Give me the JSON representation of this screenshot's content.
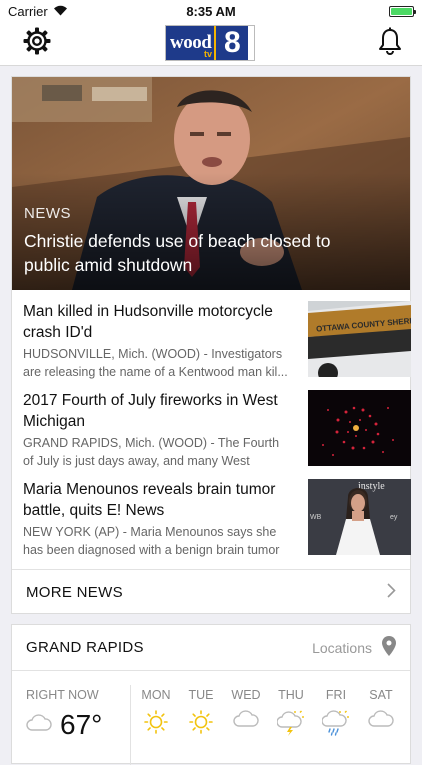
{
  "status_bar": {
    "carrier": "Carrier",
    "time": "8:35 AM",
    "battery_level": 1.0
  },
  "nav": {
    "settings_icon": "gear-icon",
    "logo_word": "wood",
    "logo_number": "8",
    "logo_tv": "tv",
    "notifications_icon": "bell-icon"
  },
  "hero": {
    "category": "NEWS",
    "headline": "Christie defends use of beach closed to public amid shutdown"
  },
  "stories": [
    {
      "title": "Man killed in Hudsonville motorcycle crash ID'd",
      "summary": "HUDSONVILLE, Mich. (WOOD) - Investigators are releasing the name of a Kentwood man kil...",
      "thumb_text": "OTTAWA COUNTY SHERIFF"
    },
    {
      "title": "2017 Fourth of July fireworks in West Michigan",
      "summary": "GRAND RAPIDS, Mich. (WOOD) - The Fourth of July is just days away, and many West Michiga..."
    },
    {
      "title": "Maria Menounos reveals brain tumor battle, quits E! News",
      "summary": "NEW YORK (AP) - Maria Menounos says she has been diagnosed with a benign brain tumor an...",
      "thumb_text": "instyle"
    }
  ],
  "more_news_label": "MORE NEWS",
  "weather": {
    "city": "GRAND RAPIDS",
    "locations_label": "Locations",
    "now_label": "RIGHT NOW",
    "now_temp": "67°",
    "days": [
      {
        "label": "MON",
        "icon": "sun-icon"
      },
      {
        "label": "TUE",
        "icon": "sun-icon"
      },
      {
        "label": "WED",
        "icon": "cloud-icon"
      },
      {
        "label": "THU",
        "icon": "thunderstorm-icon"
      },
      {
        "label": "FRI",
        "icon": "rain-sun-icon"
      },
      {
        "label": "SAT",
        "icon": "cloud-icon"
      }
    ]
  },
  "colors": {
    "brand_blue": "#1e3a8a",
    "brand_gold": "#f4b400",
    "sun": "#f2c30f",
    "battery": "#4cd964"
  }
}
